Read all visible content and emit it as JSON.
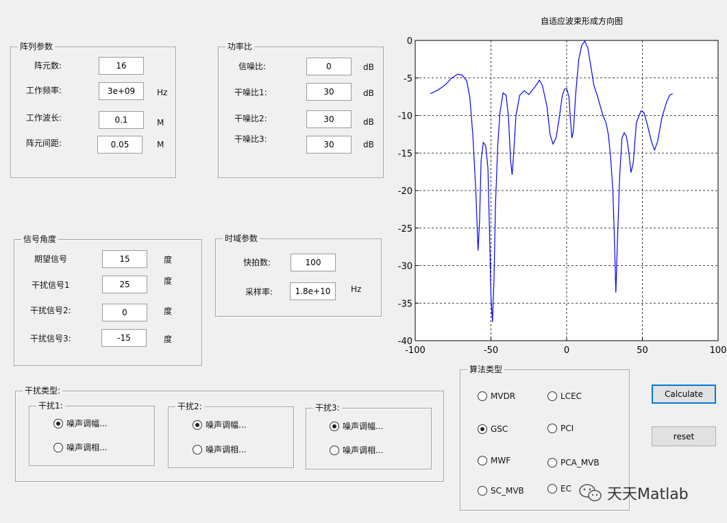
{
  "array_params": {
    "title": "阵列参数",
    "rows": [
      {
        "label": "阵元数:",
        "value": "16",
        "unit": ""
      },
      {
        "label": "工作频率:",
        "value": "3e+09",
        "unit": "Hz"
      },
      {
        "label": "工作波长:",
        "value": "0.1",
        "unit": "M"
      },
      {
        "label": "阵元间距:",
        "value": "0.05",
        "unit": "M"
      }
    ]
  },
  "power_ratio": {
    "title": "功率比",
    "rows": [
      {
        "label": "信噪比:",
        "value": "0",
        "unit": "dB"
      },
      {
        "label": "干噪比1:",
        "value": "30",
        "unit": "dB"
      },
      {
        "label": "干噪比2:",
        "value": "30",
        "unit": "dB"
      },
      {
        "label": "干噪比3:",
        "value": "30",
        "unit": "dB"
      }
    ]
  },
  "signal_angles": {
    "title": "信号角度",
    "rows": [
      {
        "label": "期望信号",
        "value": "15",
        "unit": "度"
      },
      {
        "label": "干扰信号1",
        "value": "25",
        "unit": "度"
      },
      {
        "label": "干扰信号2:",
        "value": "0",
        "unit": "度"
      },
      {
        "label": "干扰信号3:",
        "value": "-15",
        "unit": "度"
      }
    ]
  },
  "time_params": {
    "title": "时域参数",
    "rows": [
      {
        "label": "快拍数:",
        "value": "100",
        "unit": ""
      },
      {
        "label": "采样率:",
        "value": "1.8e+10",
        "unit": "Hz"
      }
    ]
  },
  "interference_type": {
    "title": "干扰类型:",
    "groups": [
      {
        "title": "干扰1:",
        "opt1": "噪声调幅...",
        "opt2": "噪声调相...",
        "selected": 0
      },
      {
        "title": "干扰2:",
        "opt1": "噪声调幅...",
        "opt2": "噪声调相...",
        "selected": 0
      },
      {
        "title": "干扰3:",
        "opt1": "噪声调幅...",
        "opt2": "噪声调相...",
        "selected": 0
      }
    ]
  },
  "algorithm": {
    "title": "算法类型",
    "options": [
      "MVDR",
      "LCEC",
      "GSC",
      "PCI",
      "MWF",
      "PCA_MVB",
      "SC_MVB",
      "EC"
    ],
    "selected": "GSC"
  },
  "buttons": {
    "calculate": "Calculate",
    "reset": "reset"
  },
  "watermark": {
    "text": "天天Matlab"
  },
  "chart_data": {
    "type": "line",
    "title": "自适应波束形成方向图",
    "xlabel": "",
    "ylabel": "",
    "xlim": [
      -100,
      100
    ],
    "ylim": [
      -40,
      0
    ],
    "xticks": [
      "-100",
      "-50",
      "0",
      "50",
      "100"
    ],
    "yticks": [
      "0",
      "-5",
      "-10",
      "-15",
      "-20",
      "-25",
      "-30",
      "-35",
      "-40"
    ],
    "grid": true,
    "series": [
      {
        "color": "#0000ff",
        "points": [
          [
            -90,
            -7.1
          ],
          [
            -85,
            -6.6
          ],
          [
            -80,
            -5.9
          ],
          [
            -76,
            -5.0
          ],
          [
            -72,
            -4.5
          ],
          [
            -69,
            -4.6
          ],
          [
            -66,
            -5.4
          ],
          [
            -64,
            -7.5
          ],
          [
            -62,
            -12.5
          ],
          [
            -60,
            -20
          ],
          [
            -58.5,
            -28
          ],
          [
            -57.5,
            -24
          ],
          [
            -56.5,
            -16
          ],
          [
            -55,
            -13.6
          ],
          [
            -53.5,
            -14
          ],
          [
            -52,
            -17
          ],
          [
            -51,
            -25
          ],
          [
            -50,
            -34
          ],
          [
            -49,
            -37.5
          ],
          [
            -48,
            -32
          ],
          [
            -47,
            -22
          ],
          [
            -45.5,
            -14
          ],
          [
            -44,
            -9.5
          ],
          [
            -42,
            -7.0
          ],
          [
            -40,
            -7.3
          ],
          [
            -38.5,
            -10
          ],
          [
            -37,
            -16
          ],
          [
            -36,
            -17.9
          ],
          [
            -35,
            -15
          ],
          [
            -33.5,
            -10
          ],
          [
            -31,
            -7.3
          ],
          [
            -28,
            -6.7
          ],
          [
            -25,
            -7.2
          ],
          [
            -21,
            -6.2
          ],
          [
            -18,
            -5.3
          ],
          [
            -16,
            -6.0
          ],
          [
            -13,
            -8.8
          ],
          [
            -11,
            -12.5
          ],
          [
            -9,
            -13.8
          ],
          [
            -7,
            -13.0
          ],
          [
            -5,
            -10.5
          ],
          [
            -3,
            -7.5
          ],
          [
            -1.5,
            -6.5
          ],
          [
            0,
            -6.4
          ],
          [
            1.5,
            -7.5
          ],
          [
            2.5,
            -10.5
          ],
          [
            3.5,
            -13.0
          ],
          [
            4.5,
            -12.0
          ],
          [
            6,
            -7.0
          ],
          [
            8,
            -2.5
          ],
          [
            10,
            -0.6
          ],
          [
            12,
            -0.1
          ],
          [
            14,
            -1.0
          ],
          [
            16,
            -3.5
          ],
          [
            18,
            -6.0
          ],
          [
            20,
            -7.2
          ],
          [
            22,
            -8.6
          ],
          [
            24,
            -10.0
          ],
          [
            26,
            -11.0
          ],
          [
            27.5,
            -12.5
          ],
          [
            29,
            -15.5
          ],
          [
            30.5,
            -20
          ],
          [
            31.5,
            -26
          ],
          [
            32.5,
            -33.6
          ],
          [
            33.5,
            -27
          ],
          [
            35,
            -18
          ],
          [
            36.5,
            -13.0
          ],
          [
            38,
            -12.3
          ],
          [
            39.5,
            -12.8
          ],
          [
            41,
            -14.8
          ],
          [
            42.5,
            -17.6
          ],
          [
            44,
            -16.3
          ],
          [
            46,
            -11.0
          ],
          [
            49,
            -9.4
          ],
          [
            51,
            -9.6
          ],
          [
            53,
            -11.0
          ],
          [
            56,
            -13.5
          ],
          [
            58,
            -14.6
          ],
          [
            60,
            -13.5
          ],
          [
            63,
            -10.2
          ],
          [
            66,
            -8.2
          ],
          [
            68,
            -7.3
          ],
          [
            70,
            -7.1
          ]
        ]
      }
    ]
  }
}
